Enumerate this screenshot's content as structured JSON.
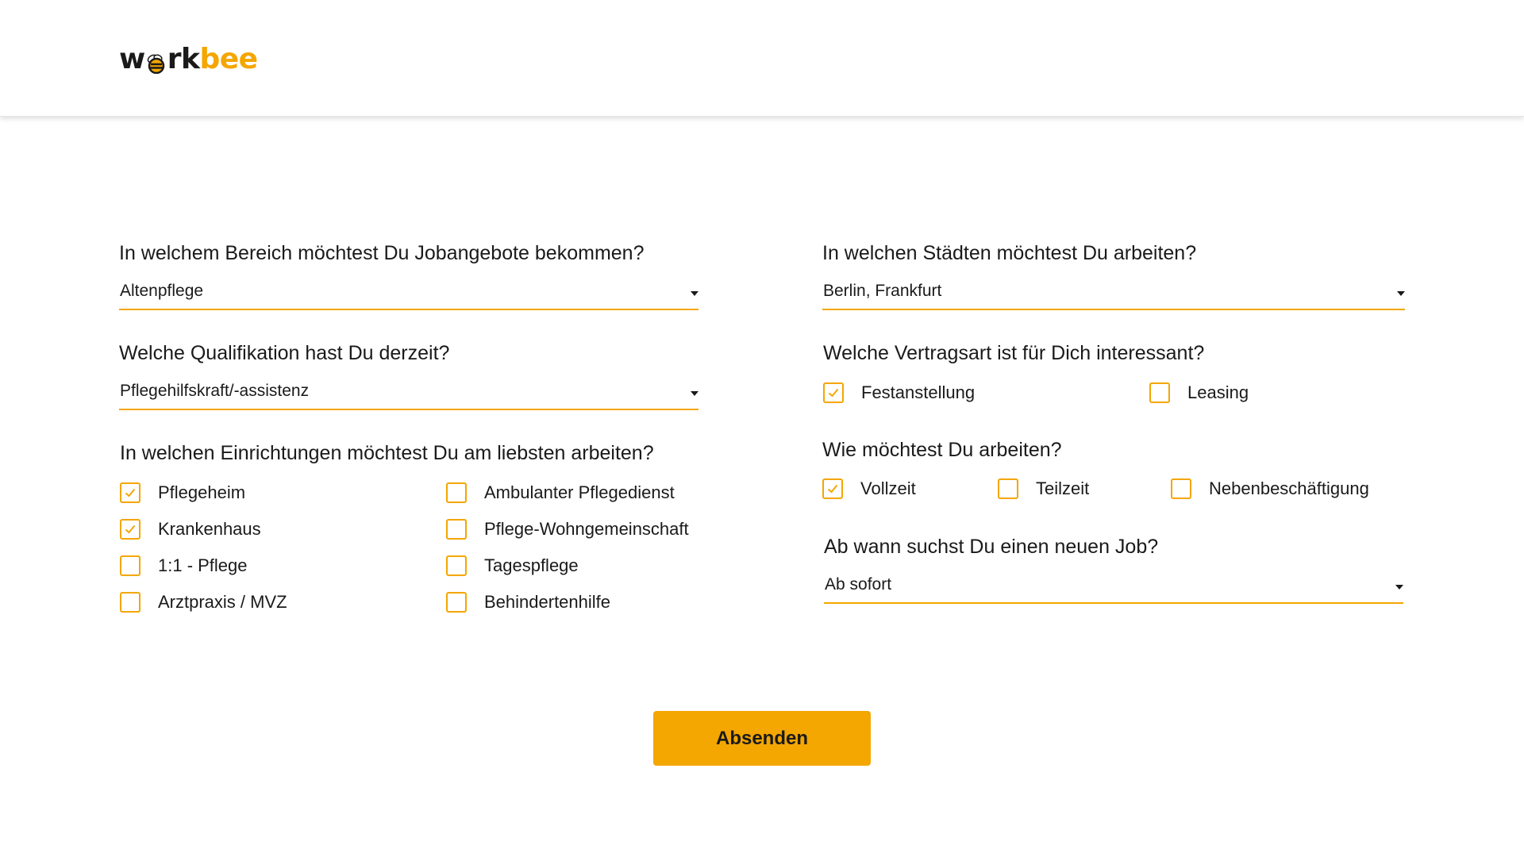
{
  "brand": {
    "logo_left": "w",
    "logo_mid": "rk",
    "logo_right": "bee",
    "accent_color": "#f4a601"
  },
  "left": {
    "bereich": {
      "label": "In welchem Bereich möchtest Du Jobangebote bekommen?",
      "value": "Altenpflege"
    },
    "qualifikation": {
      "label": "Welche Qualifikation hast Du derzeit?",
      "value": "Pflegehilfskraft/-assistenz"
    },
    "einrichtungen": {
      "label": "In welchen Einrichtungen möchtest Du am liebsten arbeiten?",
      "options": [
        {
          "label": "Pflegeheim",
          "checked": true
        },
        {
          "label": "Ambulanter Pflegedienst",
          "checked": false
        },
        {
          "label": "Krankenhaus",
          "checked": true
        },
        {
          "label": "Pflege-Wohngemeinschaft",
          "checked": false
        },
        {
          "label": "1:1 - Pflege",
          "checked": false
        },
        {
          "label": "Tagespflege",
          "checked": false
        },
        {
          "label": "Arztpraxis / MVZ",
          "checked": false
        },
        {
          "label": "Behindertenhilfe",
          "checked": false
        }
      ]
    }
  },
  "right": {
    "staedte": {
      "label": "In welchen Städten möchtest Du arbeiten?",
      "value": "Berlin, Frankfurt"
    },
    "vertragsart": {
      "label": "Welche Vertragsart ist für Dich interessant?",
      "options": [
        {
          "label": "Festanstellung",
          "checked": true
        },
        {
          "label": "Leasing",
          "checked": false
        }
      ]
    },
    "arbeitszeit": {
      "label": "Wie möchtest Du arbeiten?",
      "options": [
        {
          "label": "Vollzeit",
          "checked": true
        },
        {
          "label": "Teilzeit",
          "checked": false
        },
        {
          "label": "Nebenbeschäftigung",
          "checked": false
        }
      ]
    },
    "start": {
      "label": "Ab wann suchst Du einen neuen Job?",
      "value": "Ab sofort"
    }
  },
  "submit_label": "Absenden"
}
